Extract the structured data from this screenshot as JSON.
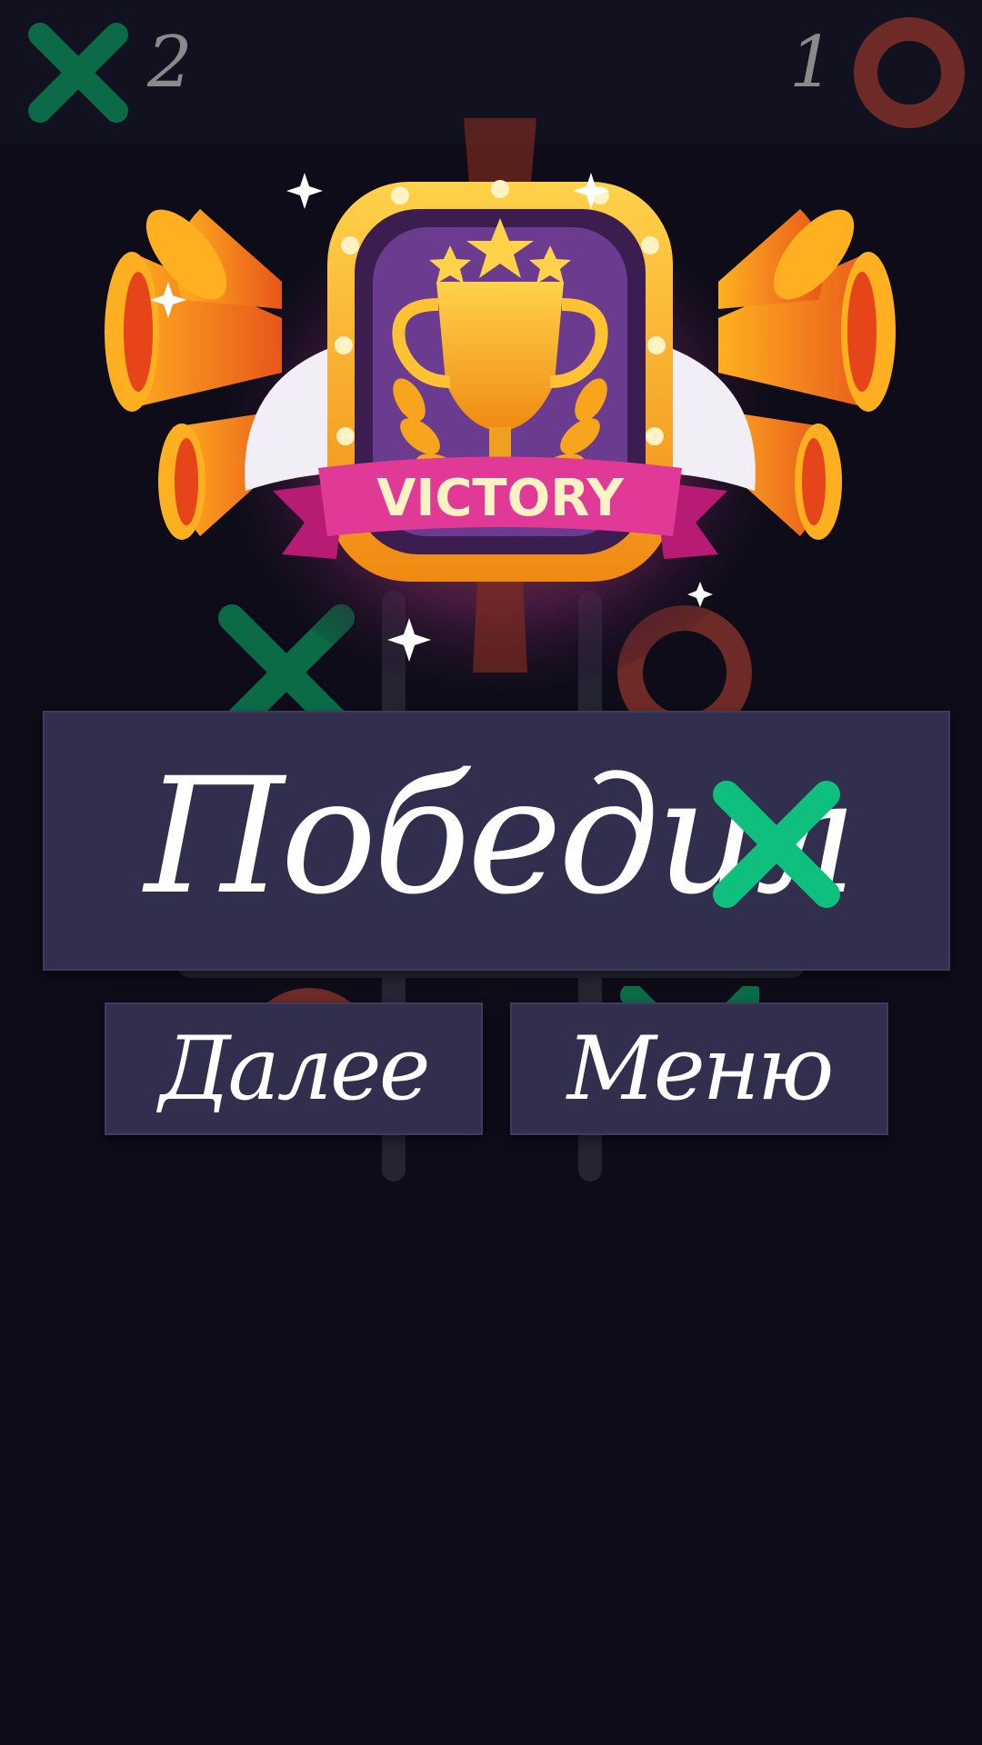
{
  "scoreboard": {
    "player_x": {
      "icon": "cross-icon",
      "score": "2",
      "color": "#0b6b46"
    },
    "player_o": {
      "icon": "circle-icon",
      "score": "1",
      "color": "#6e2a26"
    }
  },
  "victory_banner": {
    "text": "VICTORY"
  },
  "result": {
    "label": "Победил",
    "winner_icon": "cross-icon",
    "winner_color": "#0fbf7e"
  },
  "buttons": {
    "next_label": "Далее",
    "menu_label": "Меню"
  },
  "colors": {
    "background": "#0d0c18",
    "panel": "#322e4d",
    "x_mark": "#0b6b46",
    "o_mark": "#6e2a26"
  }
}
